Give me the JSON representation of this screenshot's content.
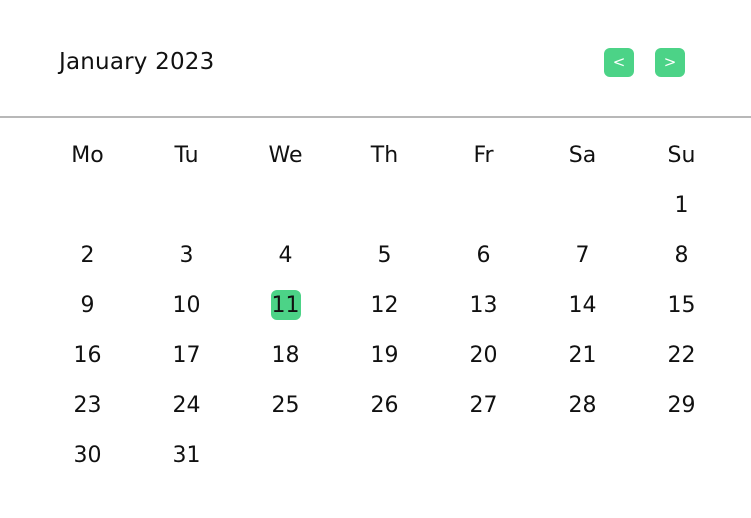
{
  "calendar": {
    "month_label": "January 2023",
    "prev_label": "<",
    "next_label": ">",
    "accent_color": "#4cd387",
    "weekdays": [
      "Mo",
      "Tu",
      "We",
      "Th",
      "Fr",
      "Sa",
      "Su"
    ],
    "weeks": [
      [
        "",
        "",
        "",
        "",
        "",
        "",
        "1"
      ],
      [
        "2",
        "3",
        "4",
        "5",
        "6",
        "7",
        "8"
      ],
      [
        "9",
        "10",
        "11",
        "12",
        "13",
        "14",
        "15"
      ],
      [
        "16",
        "17",
        "18",
        "19",
        "20",
        "21",
        "22"
      ],
      [
        "23",
        "24",
        "25",
        "26",
        "27",
        "28",
        "29"
      ],
      [
        "30",
        "31",
        "",
        "",
        "",
        "",
        ""
      ]
    ],
    "selected_day": "11"
  }
}
